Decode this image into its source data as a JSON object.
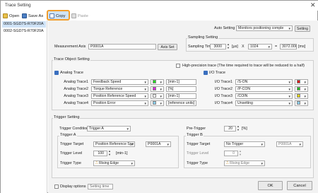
{
  "window": {
    "title": "Trace Setting",
    "close_glyph": "✕"
  },
  "toolbar": {
    "open": "Open",
    "save_as": "Save As",
    "copy": "Copy",
    "paste": "Paste"
  },
  "devices": [
    "0001-SGD7S-R70F20A",
    "0002-SGD7S-R70F20A"
  ],
  "auto_setting": {
    "label": "Auto Setting",
    "value": "Monitors positioning comple",
    "button": "Setting"
  },
  "measurement": {
    "label": "Measurement Axis",
    "value": "P0001A",
    "button": "Axis Set"
  },
  "sampling": {
    "group": "Sampling Setting",
    "label": "Sampling Time",
    "value": "3000",
    "unit": "[μs]",
    "times": "X",
    "multiplier": "1024",
    "equals": "=",
    "result": "3072.000",
    "result_unit": "[ms]"
  },
  "trace_object": {
    "group": "Trace Object Setting",
    "high_precision": "High-precision trace (The time required to trace will be reduced to a half)",
    "analog_header": "Analog Trace",
    "io_header": "I/O Trace",
    "analog": [
      {
        "label": "Analog Trace1",
        "value": "Feedback Speed",
        "unit": "[min-1]",
        "color": "#22dd22"
      },
      {
        "label": "Analog Trace2",
        "value": "Torque Reference",
        "unit": "[%]",
        "color": "#dd22dd"
      },
      {
        "label": "Analog Trace3",
        "value": "Position Reference Speed",
        "unit": "[min-1]",
        "color": "#ffffff"
      },
      {
        "label": "Analog Trace4",
        "value": "Position Error",
        "unit": "[reference units]",
        "color": "#88ccee"
      }
    ],
    "io": [
      {
        "label": "I/O Trace1",
        "value": "/S-ON",
        "color": "#dd1111"
      },
      {
        "label": "I/O Trace2",
        "value": "/P-CON",
        "color": "#22bb22"
      },
      {
        "label": "I/O Trace3",
        "value": "/COIN",
        "color": "#e0d000"
      },
      {
        "label": "I/O Trace4",
        "value": "Unsetting",
        "color": "#88ccee"
      }
    ]
  },
  "trigger": {
    "group": "Trigger Setting",
    "conditions_label": "Trigger Conditions",
    "conditions_value": "Trigger A",
    "pre_trigger_label": "Pre-Trigger",
    "pre_trigger_value": "20",
    "pre_trigger_unit": "[%]",
    "a": {
      "header": "Trigger A",
      "target_label": "Trigger Target",
      "target_value": "Position Reference Spe",
      "axis_value": "P0001A",
      "level_label": "Trigger Level",
      "level_value": "100",
      "level_unit": "[min-1]",
      "type_label": "Trigger Type",
      "type_value": "Rising Edge"
    },
    "b": {
      "header": "Trigger B",
      "target_label": "Trigger Target",
      "target_value": "No Trigger",
      "axis_value": "P0001A",
      "level_label": "Trigger Level",
      "level_value": "0",
      "type_label": "Trigger Type",
      "type_value": "Rising Edge"
    }
  },
  "footer": {
    "display_options": "Display options",
    "setting_time": "Setting time",
    "ok": "OK",
    "cancel": "Cancel"
  }
}
